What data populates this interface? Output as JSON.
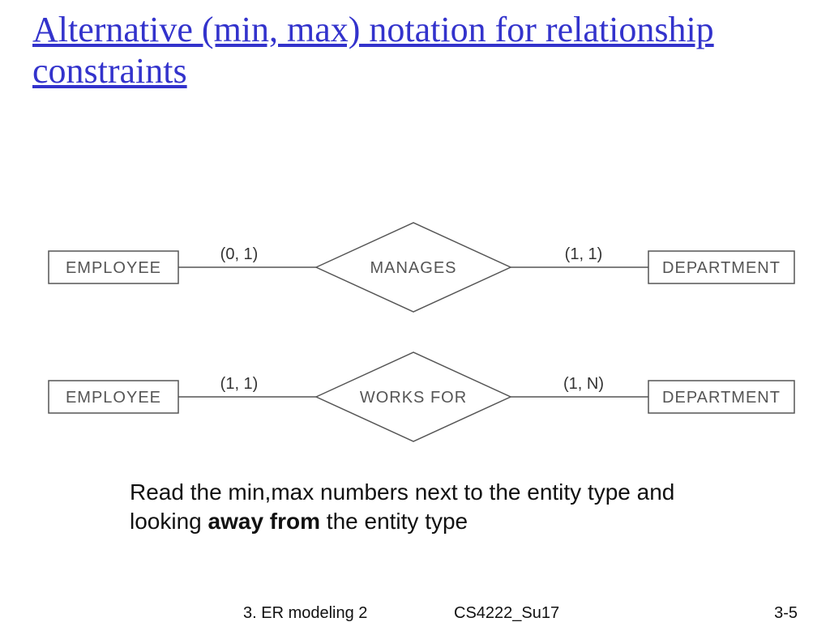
{
  "title": "Alternative (min, max) notation for relationship constraints",
  "row1": {
    "entity_left": "EMPLOYEE",
    "card_left": "(0, 1)",
    "relationship": "MANAGES",
    "card_right": "(1, 1)",
    "entity_right": "DEPARTMENT"
  },
  "row2": {
    "entity_left": "EMPLOYEE",
    "card_left": "(1, 1)",
    "relationship": "WORKS FOR",
    "card_right": "(1, N)",
    "entity_right": "DEPARTMENT"
  },
  "caption_pre": "Read the min,max numbers next to the entity type and looking ",
  "caption_bold": "away from",
  "caption_post": " the entity type",
  "footer": {
    "left": "3. ER modeling 2",
    "mid": "CS4222_Su17",
    "right": "3-5"
  }
}
